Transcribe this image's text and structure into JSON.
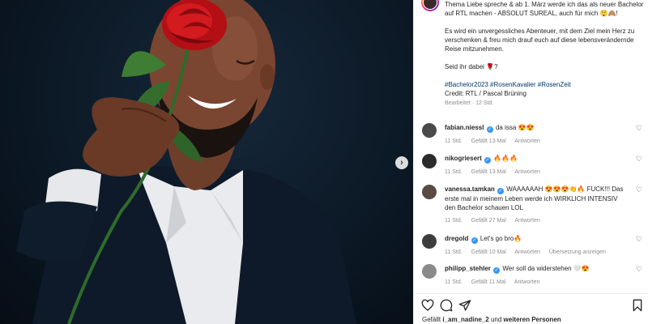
{
  "post": {
    "caption_lines": [
      "Thema Liebe spreche & ab 1. März werde ich das als neuer Bachelor auf RTL machen - ABSOLUT SUREAL, auch für mich 😲🙈!",
      "Es wird ein unvergessliches Abenteuer, mit dem Ziel mein Herz zu verschenken & freu mich drauf euch auf diese lebensverändernde Reise mitzunehmen.",
      "Seid ihr dabei 🌹?"
    ],
    "hashtags": "#Bachelor2023 #RosenKavalier #RosenZeit",
    "credit": "Credit: RTL / Pascal Brüning",
    "edited": "Bearbeitet · 12 Std."
  },
  "comments": [
    {
      "user": "fabian.niessl",
      "verified": true,
      "text": "da issa 😍😍",
      "time": "11 Std.",
      "likes": "Gefällt 13 Mal",
      "reply": "Antworten",
      "extra": "",
      "avatar_color": "#4a4a4a"
    },
    {
      "user": "nikogriesert",
      "verified": true,
      "text": "🔥🔥🔥",
      "time": "11 Std.",
      "likes": "Gefällt 13 Mal",
      "reply": "Antworten",
      "extra": "",
      "avatar_color": "#2b2b2b"
    },
    {
      "user": "vanessa.tamkan",
      "verified": true,
      "text": "WAAAAAAH 😍😍😍👏🔥 FUCK!!! Das erste mal in meinem Leben werde ich WIRKLICH INTENSIV den Bachelor schauen LOL",
      "time": "11 Std.",
      "likes": "Gefällt 27 Mal",
      "reply": "Antworten",
      "extra": "",
      "avatar_color": "#5a4a42"
    },
    {
      "user": "dregold",
      "verified": true,
      "text": "Let's go bro🔥",
      "time": "11 Std.",
      "likes": "Gefällt 10 Mal",
      "reply": "Antworten",
      "extra": "Übersetzung anzeigen",
      "avatar_color": "#3d3d3d"
    },
    {
      "user": "philipp_stehler",
      "verified": true,
      "text": "Wer soll da widerstehen 🤍😍",
      "time": "11 Std.",
      "likes": "Gefällt 11 Mal",
      "reply": "Antworten",
      "extra": "",
      "avatar_color": "#8a8a8a"
    }
  ],
  "footer": {
    "likes_prefix": "Gefällt ",
    "likes_user": "i_am_nadine_2",
    "likes_mid": " und ",
    "likes_others": "weiteren Personen"
  },
  "icons": {
    "next": "chevron-right-icon",
    "like": "heart-outline-icon",
    "comment": "comment-icon",
    "share": "send-icon",
    "save": "bookmark-icon"
  },
  "colors": {
    "link": "#00376b",
    "verified": "#3897f0",
    "meta": "#8e8e8e"
  }
}
